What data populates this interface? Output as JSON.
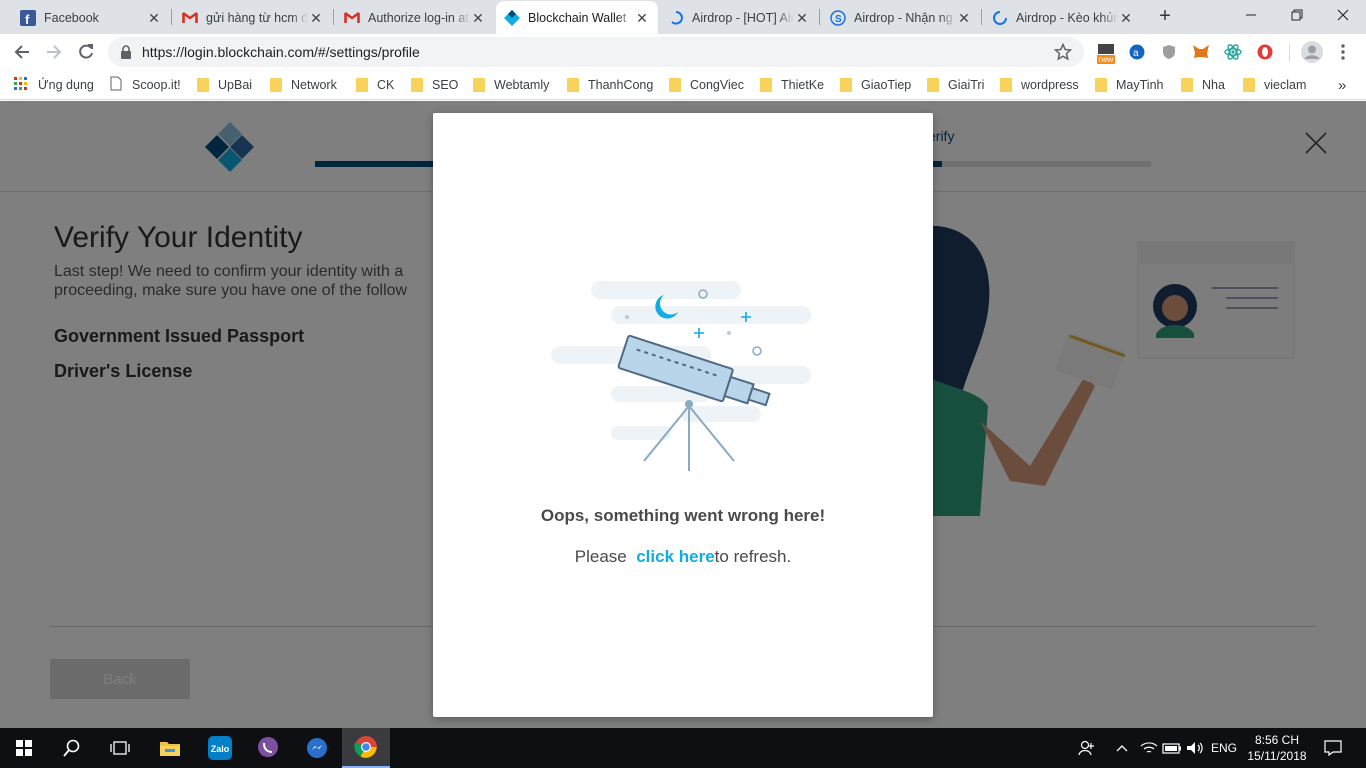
{
  "browser": {
    "tabs": [
      {
        "title": "Facebook"
      },
      {
        "title": "gửi hàng từ hcm đi"
      },
      {
        "title": "Authorize log-in at"
      },
      {
        "title": "Blockchain Wallet"
      },
      {
        "title": "Airdrop - [HOT] Air"
      },
      {
        "title": "Airdrop - Nhận ng"
      },
      {
        "title": "Airdrop - Kèo khủng"
      }
    ],
    "url": "https://login.blockchain.com/#/settings/profile",
    "extension_badge": "new",
    "bookmarks": [
      "Ứng dụng",
      "Scoop.it!",
      "UpBai",
      "Network",
      "CK",
      "SEO",
      "Webtamly",
      "ThanhCong",
      "CongViec",
      "ThietKe",
      "GiaoTiep",
      "GiaiTri",
      "wordpress",
      "MayTinh",
      "Nha",
      "vieclam"
    ],
    "more_bookmarks": "»"
  },
  "page": {
    "heading": "Verify Your Identity",
    "intro_line1": "Last step! We need to confirm your identity with a",
    "intro_line2": "proceeding, make sure you have one of the follow",
    "doc1": "Government Issued Passport",
    "doc2": "Driver's License",
    "step_label": "erify",
    "back_button": "Back"
  },
  "modal": {
    "title": "Oops, something went wrong here!",
    "msg_prefix": "Please",
    "link": "click here",
    "msg_suffix": "to refresh."
  },
  "taskbar": {
    "lang": "ENG",
    "time": "8:56 CH",
    "date": "15/11/2018",
    "zalo": "Zalo"
  },
  "colors": {
    "accent": "#10ade4",
    "brand_dark": "#004a7c",
    "tab_strip": "#dee1e6",
    "taskbar": "#0e0f12"
  }
}
